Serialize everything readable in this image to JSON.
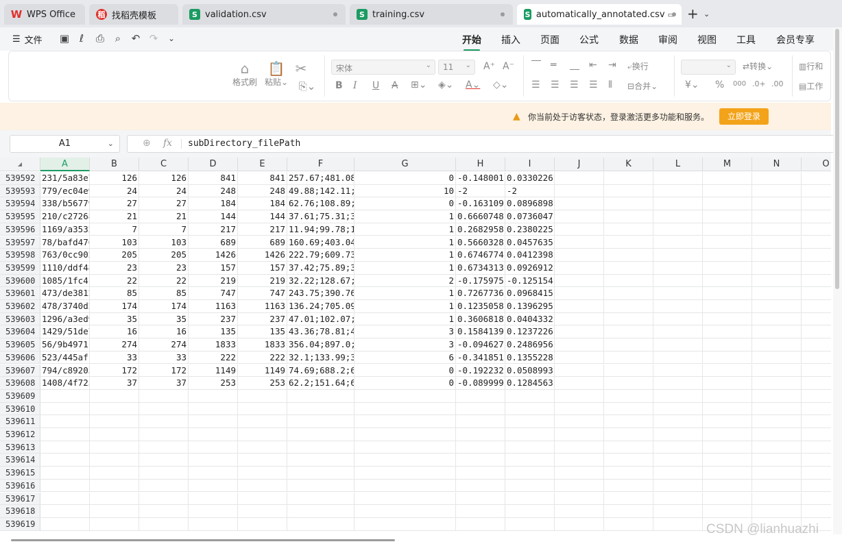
{
  "tabs": [
    {
      "label": "WPS Office",
      "icon": "wps-logo-icon"
    },
    {
      "label": "找稻壳模板",
      "icon": "docer-icon"
    },
    {
      "label": "validation.csv",
      "icon": "spreadsheet-icon"
    },
    {
      "label": "training.csv",
      "icon": "spreadsheet-icon"
    },
    {
      "label": "automatically_annotated.csv",
      "icon": "spreadsheet-icon"
    }
  ],
  "menu": {
    "file": "文件",
    "ribbon_tabs": [
      "开始",
      "插入",
      "页面",
      "公式",
      "数据",
      "审阅",
      "视图",
      "工具",
      "会员专享"
    ]
  },
  "ribbon": {
    "format_painter": "格式刷",
    "paste": "粘贴",
    "font_name": "宋体",
    "font_size": "11",
    "wrap": "换行",
    "merge": "合并",
    "convert": "转换",
    "rows_cols": "行和",
    "worksheet": "工作"
  },
  "notice": {
    "message": "你当前处于访客状态，登录激活更多功能和服务。",
    "login": "立即登录"
  },
  "formula": {
    "name_box": "A1",
    "fx": "fx",
    "value": "subDirectory_filePath"
  },
  "grid": {
    "corner": "◢",
    "columns": [
      "A",
      "B",
      "C",
      "D",
      "E",
      "F",
      "G",
      "H",
      "I",
      "J",
      "K",
      "L",
      "M",
      "N",
      "O"
    ],
    "rows": [
      {
        "num": "539592",
        "cells": [
          "231/5a83e7",
          "126",
          "126",
          "841",
          "841",
          "257.67;481.08",
          "0",
          "-0.148001",
          "0.0330226"
        ]
      },
      {
        "num": "539593",
        "cells": [
          "779/ec04e9",
          "24",
          "24",
          "248",
          "248",
          "49.88;142.11;",
          "10",
          "-2",
          "-2"
        ]
      },
      {
        "num": "539594",
        "cells": [
          "338/b56779",
          "27",
          "27",
          "184",
          "184",
          "62.76;108.89;",
          "0",
          "-0.163109",
          "0.0896898"
        ]
      },
      {
        "num": "539595",
        "cells": [
          "210/c27268",
          "21",
          "21",
          "144",
          "144",
          "37.61;75.31;3",
          "1",
          "0.6660748",
          "0.0736047"
        ]
      },
      {
        "num": "539596",
        "cells": [
          "1169/a3532",
          "7",
          "7",
          "217",
          "217",
          "11.94;99.78;1",
          "1",
          "0.2682958",
          "0.2380225"
        ]
      },
      {
        "num": "539597",
        "cells": [
          "78/bafd476",
          "103",
          "103",
          "689",
          "689",
          "160.69;403.04",
          "1",
          "0.5660328",
          "0.0457635"
        ]
      },
      {
        "num": "539598",
        "cells": [
          "763/0cc902",
          "205",
          "205",
          "1426",
          "1426",
          "222.79;609.73",
          "1",
          "0.6746774",
          "0.0412398"
        ]
      },
      {
        "num": "539599",
        "cells": [
          "1110/ddf48",
          "23",
          "23",
          "157",
          "157",
          "37.42;75.89;3",
          "1",
          "0.6734313",
          "0.0926912"
        ]
      },
      {
        "num": "539600",
        "cells": [
          "1085/1fc4c",
          "22",
          "22",
          "219",
          "219",
          "32.22;128.67;",
          "2",
          "-0.175975",
          "-0.125154"
        ]
      },
      {
        "num": "539601",
        "cells": [
          "473/de3812",
          "85",
          "85",
          "747",
          "747",
          "243.75;390.76",
          "1",
          "0.7267736",
          "0.0968415"
        ]
      },
      {
        "num": "539602",
        "cells": [
          "478/3740d2",
          "174",
          "174",
          "1163",
          "1163",
          "136.24;705.09",
          "1",
          "0.1235058",
          "0.1396295"
        ]
      },
      {
        "num": "539603",
        "cells": [
          "1296/a3ed9",
          "35",
          "35",
          "237",
          "237",
          "47.01;102.07;",
          "1",
          "0.3606818",
          "0.0404332"
        ]
      },
      {
        "num": "539604",
        "cells": [
          "1429/51de7",
          "16",
          "16",
          "135",
          "135",
          "43.36;78.81;4",
          "3",
          "0.1584139",
          "0.1237226"
        ]
      },
      {
        "num": "539605",
        "cells": [
          "56/9b4971c",
          "274",
          "274",
          "1833",
          "1833",
          "356.04;897.0;",
          "3",
          "-0.094627",
          "0.2486956"
        ]
      },
      {
        "num": "539606",
        "cells": [
          "523/445af1",
          "33",
          "33",
          "222",
          "222",
          "32.1;133.99;3",
          "6",
          "-0.341851",
          "0.1355228"
        ]
      },
      {
        "num": "539607",
        "cells": [
          "794/c89203",
          "172",
          "172",
          "1149",
          "1149",
          "74.69;688.2;6",
          "0",
          "-0.192232",
          "0.0508993"
        ]
      },
      {
        "num": "539608",
        "cells": [
          "1408/4f725",
          "37",
          "37",
          "253",
          "253",
          "62.2;151.64;6",
          "0",
          "-0.089999",
          "0.1284563"
        ]
      },
      {
        "num": "539609",
        "cells": []
      },
      {
        "num": "539610",
        "cells": []
      },
      {
        "num": "539611",
        "cells": []
      },
      {
        "num": "539612",
        "cells": []
      },
      {
        "num": "539613",
        "cells": []
      },
      {
        "num": "539614",
        "cells": []
      },
      {
        "num": "539615",
        "cells": []
      },
      {
        "num": "539616",
        "cells": []
      },
      {
        "num": "539617",
        "cells": []
      },
      {
        "num": "539618",
        "cells": []
      },
      {
        "num": "539619",
        "cells": []
      }
    ]
  },
  "watermark": "CSDN @lianhuazhi"
}
